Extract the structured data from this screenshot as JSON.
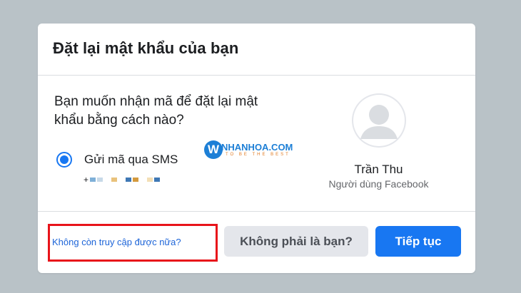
{
  "dialog": {
    "title": "Đặt lại mật khẩu của bạn",
    "question": "Bạn muốn nhận mã để đặt lại mật khẩu bằng cách nào?",
    "option_label": "Gửi mã qua SMS",
    "masked_phone_prefix": "+",
    "user": {
      "name": "Trần Thu",
      "type": "Người dùng Facebook"
    },
    "footer": {
      "link_label": "Không còn truy cập được nữa?",
      "secondary_button": "Không phải là bạn?",
      "primary_button": "Tiếp tục"
    }
  },
  "watermark": {
    "letter": "W",
    "brand": "NHANHOA.COM",
    "tagline": "TO BE THE BEST"
  },
  "colors": {
    "accent": "#1877f2",
    "highlight_border": "#e8131a",
    "background": "#b9c2c7"
  }
}
